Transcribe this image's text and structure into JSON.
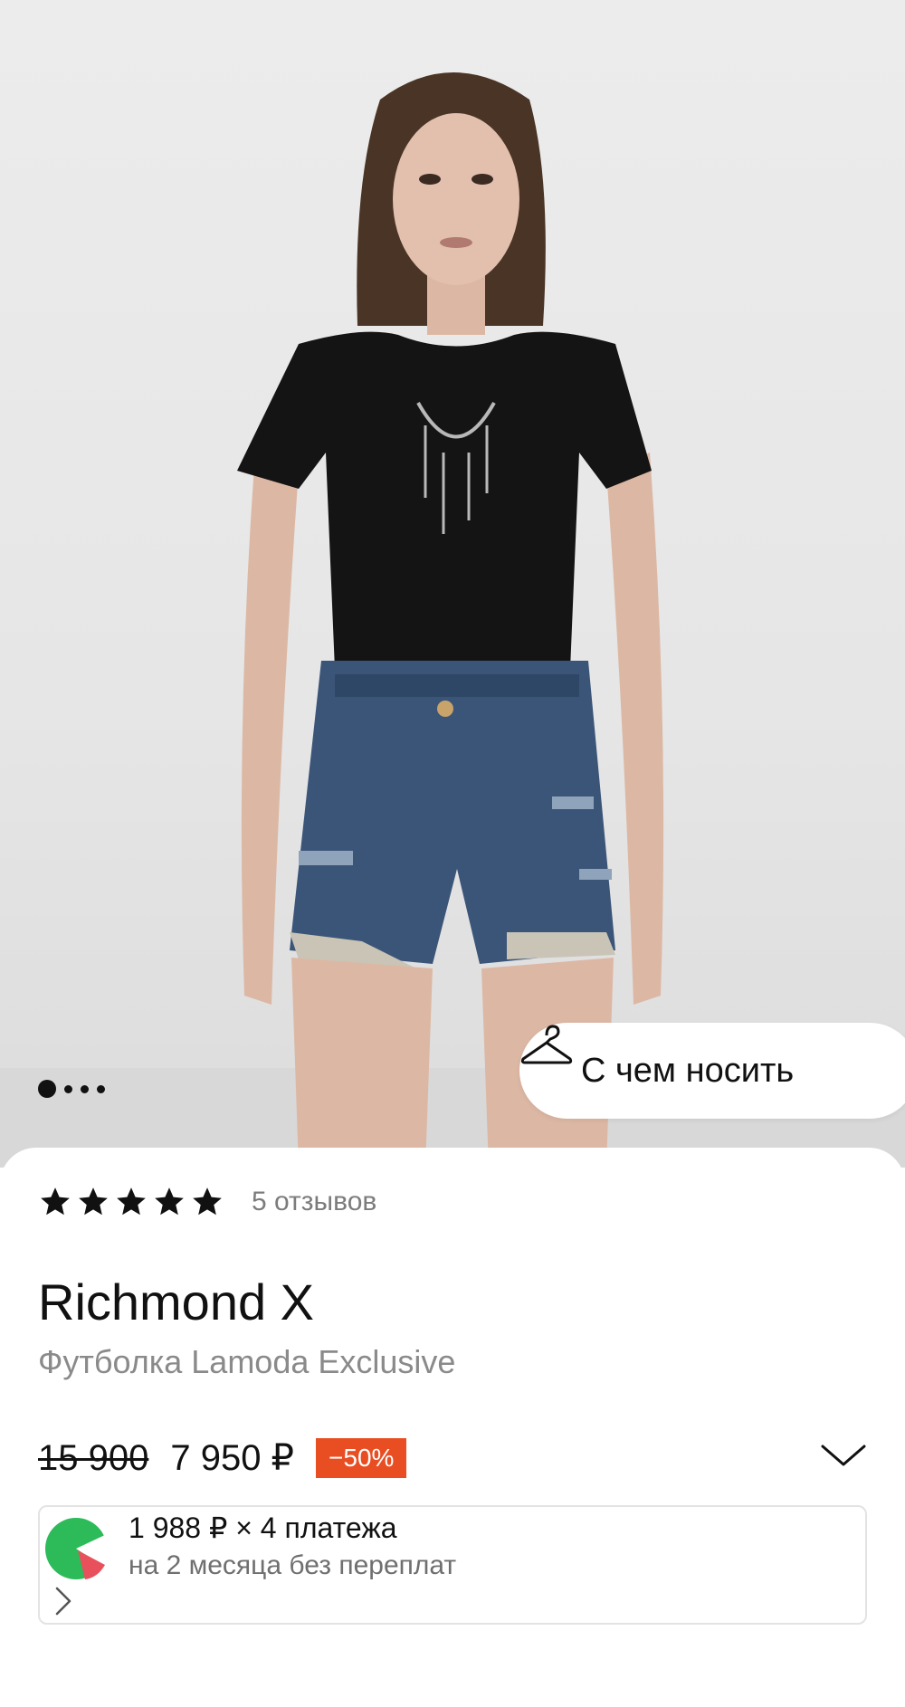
{
  "product_photo": {
    "icon": "model-photo"
  },
  "gallery": {
    "pages": 4,
    "active": 1
  },
  "wear_button": {
    "label": "С чем носить",
    "icon": "hanger-icon"
  },
  "rating": {
    "stars": 5,
    "max": 5,
    "reviews": "5 отзывов"
  },
  "product": {
    "brand": "Richmond X",
    "title": "Футболка Lamoda Exclusive"
  },
  "price": {
    "old": "15 900",
    "current": "7 950 ₽",
    "discount": "−50%",
    "expand_icon": "chevron-down-icon"
  },
  "split_payment": {
    "main": "1 988 ₽ × 4 платежа",
    "sub": "на 2 месяца без переплат",
    "logo_icon": "split-logo-icon",
    "arrow_icon": "chevron-right-icon"
  },
  "colors": {
    "discount_bg": "#e94d22",
    "split_green": "#2dbb5a",
    "split_red": "#e8505b"
  }
}
